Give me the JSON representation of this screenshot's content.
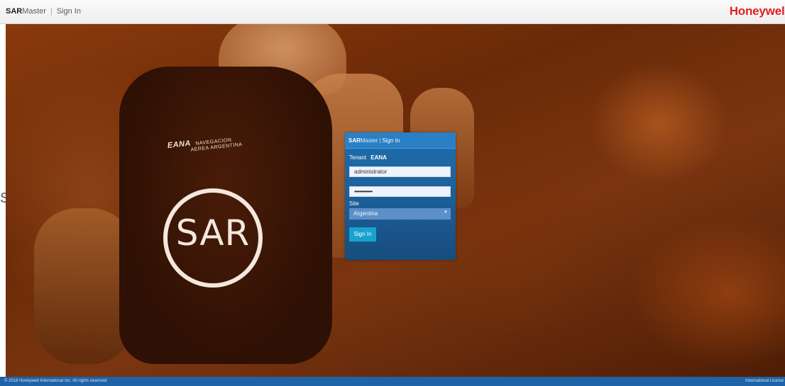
{
  "header": {
    "brand_sar": "SAR",
    "brand_master": "Master",
    "brand_sep": "|",
    "page": "Sign In",
    "logo": "Honeywell",
    "logo_color": "#e02020"
  },
  "hero": {
    "backpack_brand": "EANA",
    "backpack_line1": "NAVEGACION",
    "backpack_line2": "AEREA ARGENTINA",
    "patch_text": "SAR",
    "stray_char": "S"
  },
  "signin": {
    "title_sar": "SAR",
    "title_master": "Master",
    "title_sep": "|",
    "title_page": "Sign In",
    "tenant_label": "Tenant",
    "tenant_value": "EANA",
    "username": "administrator",
    "password": "••••••••••••••",
    "site_label": "Site",
    "site_value": "Argentina",
    "site_caret": "▼",
    "button_label": "Sign In"
  },
  "footer": {
    "copyright": "© 2018 Honeywell International Inc. All rights reserved",
    "license": "International License"
  },
  "colors": {
    "panel": "#1c5f98",
    "button": "#1aa2cf",
    "footer": "#1e63a8"
  }
}
